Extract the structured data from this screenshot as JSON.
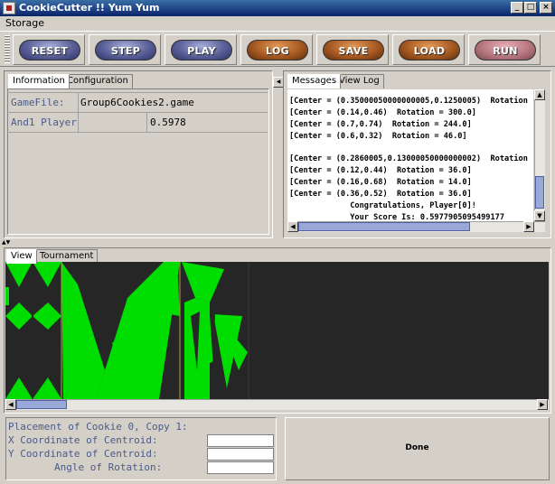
{
  "window": {
    "title": "CookieCutter !! Yum Yum",
    "minimize": "_",
    "maximize": "□",
    "close": "×"
  },
  "menu": {
    "items": [
      "Storage"
    ]
  },
  "toolbar": {
    "buttons": [
      {
        "label": "RESET",
        "style": "blue"
      },
      {
        "label": "STEP",
        "style": "blue"
      },
      {
        "label": "PLAY",
        "style": "blue"
      },
      {
        "label": "LOG",
        "style": "brown"
      },
      {
        "label": "SAVE",
        "style": "brown"
      },
      {
        "label": "LOAD",
        "style": "brown"
      },
      {
        "label": "RUN",
        "style": "pink"
      }
    ]
  },
  "info_panel": {
    "tabs": [
      "Information",
      "Configuration"
    ],
    "rows": [
      {
        "label": "GameFile:",
        "value": "Group6Cookies2.game"
      },
      {
        "label": "And1 Player",
        "value": "0.5978"
      }
    ]
  },
  "messages_panel": {
    "tabs": [
      "Messages",
      "View Log"
    ],
    "lines": [
      "[Center = (0.35000050000000005,0.1250005)  Rotation",
      "[Center = (0.14,0.46)  Rotation = 300.0]",
      "[Center = (0.7,0.74)  Rotation = 244.0]",
      "[Center = (0.6,0.32)  Rotation = 46.0]",
      "",
      "[Center = (0.2860005,0.13000050000000002)  Rotation",
      "[Center = (0.12,0.44)  Rotation = 36.0]",
      "[Center = (0.16,0.68)  Rotation = 14.0]",
      "[Center = (0.36,0.52)  Rotation = 36.0]",
      "             Congratulations, Player[0]!",
      "             Your Score Is: 0.5977905095499177"
    ]
  },
  "view_panel": {
    "tabs": [
      "View",
      "Tournament"
    ],
    "cookie_color": "#00dd00",
    "background_color": "#262626"
  },
  "placement": {
    "title": "Placement of Cookie 0, Copy 1:",
    "x_label": "X Coordinate of Centroid:",
    "y_label": "Y Coordinate of Centroid:",
    "angle_label": "Angle of Rotation:",
    "x_value": "",
    "y_value": "",
    "angle_value": ""
  },
  "done": {
    "label": "Done"
  }
}
